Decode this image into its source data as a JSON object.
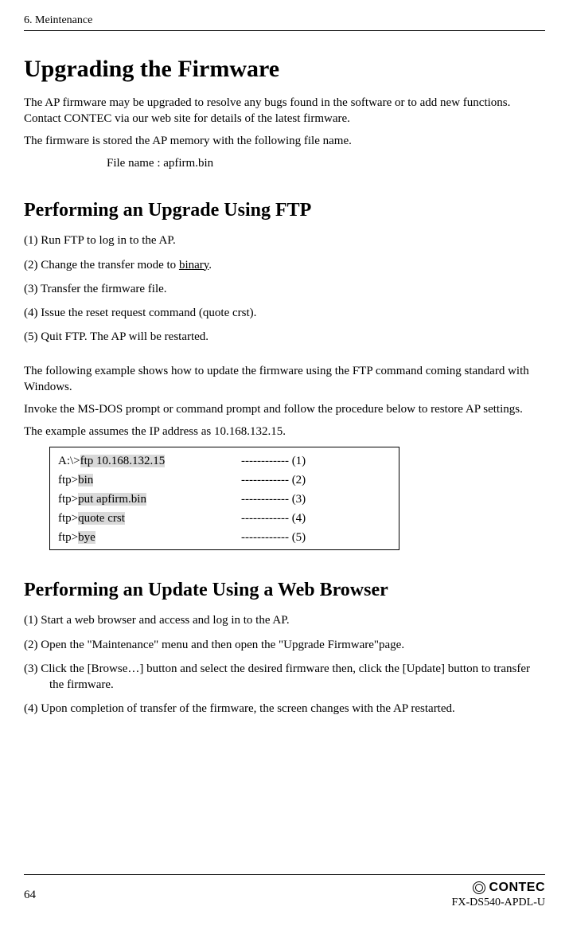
{
  "header": {
    "chapter": "6. Meintenance"
  },
  "title": "Upgrading the Firmware",
  "intro": {
    "p1": "The AP firmware may be upgraded to resolve any bugs found in the software or to add new functions. Contact CONTEC via our web site for details of the latest firmware.",
    "p2": "The firmware is stored the AP memory with the following file name.",
    "file": "File name : apfirm.bin"
  },
  "ftp": {
    "heading": "Performing an Upgrade Using FTP",
    "steps": {
      "s1a": "(1)  Run FTP to log in to the AP.",
      "s2a": "(2)  Change the transfer mode to ",
      "s2u": "binary",
      "s2b": ".",
      "s3": "(3)  Transfer the firmware file.",
      "s4": "(4)  Issue the reset request command (quote crst).",
      "s5": "(5)  Quit FTP.  The AP will be restarted."
    },
    "notes": {
      "n1": "The following example shows how to update the firmware using the FTP command coming standard with Windows.",
      "n2": "Invoke the MS-DOS prompt or command prompt and follow the procedure below to restore AP settings.",
      "n3": "The example assumes the IP address as 10.168.132.15."
    },
    "cmd": {
      "r1": {
        "pre": "A:\\>",
        "hl": "ftp 10.168.132.15",
        "mark": "------------ (1)"
      },
      "r2": {
        "pre": "ftp>",
        "hl": "bin",
        "mark": "------------ (2)"
      },
      "r3": {
        "pre": "ftp>",
        "hl": "put apfirm.bin",
        "mark": "------------ (3)"
      },
      "r4": {
        "pre": "ftp>",
        "hl": "quote crst",
        "mark": "------------ (4)"
      },
      "r5": {
        "pre": "ftp>",
        "hl": "bye",
        "mark": "------------ (5)"
      }
    }
  },
  "web": {
    "heading": "Performing an Update Using a Web Browser",
    "steps": {
      "s1": "(1)   Start a web browser and access and log in to the AP.",
      "s2": "(2)  Open the \"Maintenance\" menu and then open the \"Upgrade Firmware\"page.",
      "s3": "(3)   Click the [Browse…] button and select the desired firmware then, click the [Update] button to transfer the firmware.",
      "s4": "(4)  Upon completion of transfer of the firmware, the screen changes with the AP restarted."
    }
  },
  "footer": {
    "page": "64",
    "brand": "CONTEC",
    "model": "FX-DS540-APDL-U"
  }
}
